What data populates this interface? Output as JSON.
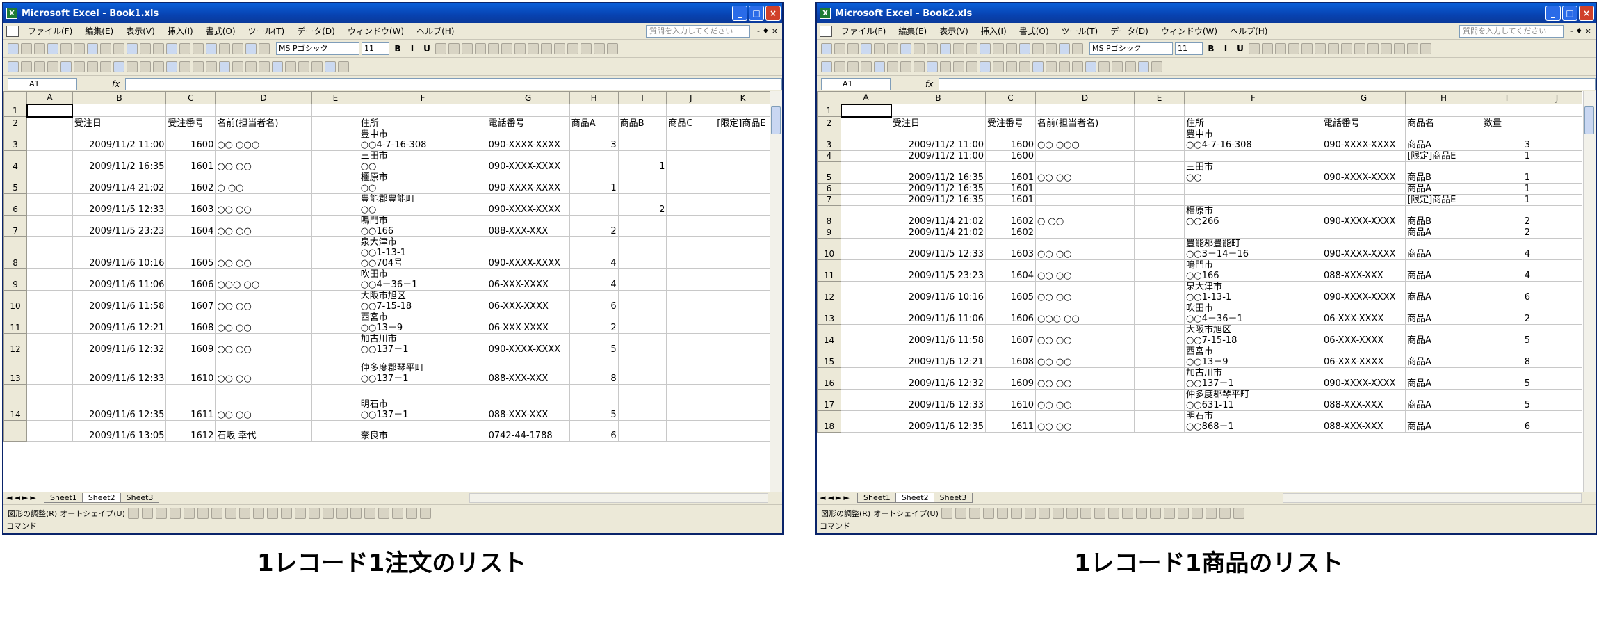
{
  "menu": [
    "ファイル(F)",
    "編集(E)",
    "表示(V)",
    "挿入(I)",
    "書式(O)",
    "ツール(T)",
    "データ(D)",
    "ウィンドウ(W)",
    "ヘルプ(H)"
  ],
  "help_placeholder": "質問を入力してください",
  "font_name": "MS Pゴシック",
  "font_size": "11",
  "cell_ref": "A1",
  "fx": "fx",
  "status": "コマンド",
  "sheets": [
    "Sheet1",
    "Sheet2",
    "Sheet3"
  ],
  "drawing_label": "図形の調整(R)",
  "autoshape_label": "オートシェイプ(U)",
  "windows": [
    {
      "title": "Microsoft Excel - Book1.xls",
      "active_sheet": 1,
      "caption": "1レコード1注文のリスト",
      "columns": [
        "A",
        "B",
        "C",
        "D",
        "E",
        "F",
        "G",
        "H",
        "I",
        "J",
        "K"
      ],
      "rows": [
        {
          "n": "1",
          "c": [
            "",
            "",
            "",
            "",
            "",
            "",
            "",
            "",
            "",
            "",
            ""
          ]
        },
        {
          "n": "2",
          "c": [
            "",
            "受注日",
            "受注番号",
            "名前(担当者名)",
            "",
            "住所",
            "電話番号",
            "商品A",
            "商品B",
            "商品C",
            "[限定]商品E"
          ]
        },
        {
          "n": "3",
          "c": [
            "",
            "2009/11/2 11:00",
            "1600",
            "○○ ○○○",
            "",
            "豊中市\n○○4-7-16-308",
            "090-XXXX-XXXX",
            "3",
            "",
            "",
            ""
          ]
        },
        {
          "n": "4",
          "c": [
            "",
            "2009/11/2 16:35",
            "1601",
            "○○ ○○",
            "",
            "三田市\n○○",
            "090-XXXX-XXXX",
            "",
            "1",
            "",
            ""
          ]
        },
        {
          "n": "5",
          "c": [
            "",
            "2009/11/4 21:02",
            "1602",
            "○ ○○",
            "",
            "橿原市\n○○",
            "090-XXXX-XXXX",
            "1",
            "",
            "",
            ""
          ]
        },
        {
          "n": "6",
          "c": [
            "",
            "2009/11/5 12:33",
            "1603",
            "○○ ○○",
            "",
            "豊能郡豊能町\n○○",
            "090-XXXX-XXXX",
            "",
            "2",
            "",
            ""
          ]
        },
        {
          "n": "7",
          "c": [
            "",
            "2009/11/5 23:23",
            "1604",
            "○○ ○○",
            "",
            "鳴門市\n○○166",
            "088-XXX-XXX",
            "2",
            "",
            "",
            ""
          ]
        },
        {
          "n": "8",
          "c": [
            "",
            "2009/11/6 10:16",
            "1605",
            "○○ ○○",
            "",
            "泉大津市\n○○1-13-1\n○○704号",
            "090-XXXX-XXXX",
            "4",
            "",
            "",
            ""
          ]
        },
        {
          "n": "9",
          "c": [
            "",
            "2009/11/6 11:06",
            "1606",
            "○○○ ○○",
            "",
            "吹田市\n○○4－36－1",
            "06-XXX-XXXX",
            "4",
            "",
            "",
            ""
          ]
        },
        {
          "n": "10",
          "c": [
            "",
            "2009/11/6 11:58",
            "1607",
            "○○ ○○",
            "",
            "大阪市旭区\n○○7-15-18",
            "06-XXX-XXXX",
            "6",
            "",
            "",
            ""
          ]
        },
        {
          "n": "11",
          "c": [
            "",
            "2009/11/6 12:21",
            "1608",
            "○○ ○○",
            "",
            "西宮市\n○○13－9",
            "06-XXX-XXXX",
            "2",
            "",
            "",
            ""
          ]
        },
        {
          "n": "12",
          "c": [
            "",
            "2009/11/6 12:32",
            "1609",
            "○○ ○○",
            "",
            "加古川市\n○○137－1",
            "090-XXXX-XXXX",
            "5",
            "",
            "",
            ""
          ]
        },
        {
          "n": "13",
          "c": [
            "",
            "2009/11/6 12:33",
            "1610",
            "○○ ○○",
            "",
            "仲多度郡琴平町\n○○137－1",
            "088-XXX-XXX",
            "8",
            "",
            "",
            ""
          ]
        },
        {
          "n": "14",
          "c": [
            "",
            "2009/11/6 12:35",
            "1611",
            "○○ ○○",
            "",
            "明石市\n○○137－1",
            "088-XXX-XXX",
            "5",
            "",
            "",
            ""
          ]
        },
        {
          "n": "",
          "c": [
            "",
            "2009/11/6 13:05",
            "1612",
            "石坂 幸代",
            "",
            "奈良市",
            "0742-44-1788",
            "6",
            "",
            "",
            ""
          ]
        }
      ]
    },
    {
      "title": "Microsoft Excel - Book2.xls",
      "active_sheet": 1,
      "caption": "1レコード1商品のリスト",
      "columns": [
        "A",
        "B",
        "C",
        "D",
        "E",
        "F",
        "G",
        "H",
        "I",
        "J"
      ],
      "rows": [
        {
          "n": "1",
          "c": [
            "",
            "",
            "",
            "",
            "",
            "",
            "",
            "",
            "",
            ""
          ]
        },
        {
          "n": "2",
          "c": [
            "",
            "受注日",
            "受注番号",
            "名前(担当者名)",
            "",
            "住所",
            "電話番号",
            "商品名",
            "数量",
            ""
          ]
        },
        {
          "n": "3",
          "c": [
            "",
            "2009/11/2 11:00",
            "1600",
            "○○ ○○○",
            "",
            "豊中市\n○○4-7-16-308",
            "090-XXXX-XXXX",
            "商品A",
            "3",
            ""
          ]
        },
        {
          "n": "4",
          "c": [
            "",
            "2009/11/2 11:00",
            "1600",
            "",
            "",
            "",
            "",
            "[限定]商品E",
            "1",
            ""
          ]
        },
        {
          "n": "5",
          "c": [
            "",
            "2009/11/2 16:35",
            "1601",
            "○○ ○○",
            "",
            "三田市\n○○",
            "090-XXXX-XXXX",
            "商品B",
            "1",
            ""
          ]
        },
        {
          "n": "6",
          "c": [
            "",
            "2009/11/2 16:35",
            "1601",
            "",
            "",
            "",
            "",
            "商品A",
            "1",
            ""
          ]
        },
        {
          "n": "7",
          "c": [
            "",
            "2009/11/2 16:35",
            "1601",
            "",
            "",
            "",
            "",
            "[限定]商品E",
            "1",
            ""
          ]
        },
        {
          "n": "8",
          "c": [
            "",
            "2009/11/4 21:02",
            "1602",
            "○ ○○",
            "",
            "橿原市\n○○266",
            "090-XXXX-XXXX",
            "商品B",
            "2",
            ""
          ]
        },
        {
          "n": "9",
          "c": [
            "",
            "2009/11/4 21:02",
            "1602",
            "",
            "",
            "",
            "",
            "商品A",
            "2",
            ""
          ]
        },
        {
          "n": "10",
          "c": [
            "",
            "2009/11/5 12:33",
            "1603",
            "○○ ○○",
            "",
            "豊能郡豊能町\n○○3－14－16",
            "090-XXXX-XXXX",
            "商品A",
            "4",
            ""
          ]
        },
        {
          "n": "11",
          "c": [
            "",
            "2009/11/5 23:23",
            "1604",
            "○○ ○○",
            "",
            "鳴門市\n○○166",
            "088-XXX-XXX",
            "商品A",
            "4",
            ""
          ]
        },
        {
          "n": "12",
          "c": [
            "",
            "2009/11/6 10:16",
            "1605",
            "○○ ○○",
            "",
            "泉大津市\n○○1-13-1",
            "090-XXXX-XXXX",
            "商品A",
            "6",
            ""
          ]
        },
        {
          "n": "13",
          "c": [
            "",
            "2009/11/6 11:06",
            "1606",
            "○○○ ○○",
            "",
            "吹田市\n○○4－36－1",
            "06-XXX-XXXX",
            "商品A",
            "2",
            ""
          ]
        },
        {
          "n": "14",
          "c": [
            "",
            "2009/11/6 11:58",
            "1607",
            "○○ ○○",
            "",
            "大阪市旭区\n○○7-15-18",
            "06-XXX-XXXX",
            "商品A",
            "5",
            ""
          ]
        },
        {
          "n": "15",
          "c": [
            "",
            "2009/11/6 12:21",
            "1608",
            "○○ ○○",
            "",
            "西宮市\n○○13－9",
            "06-XXX-XXXX",
            "商品A",
            "8",
            ""
          ]
        },
        {
          "n": "16",
          "c": [
            "",
            "2009/11/6 12:32",
            "1609",
            "○○ ○○",
            "",
            "加古川市\n○○137－1",
            "090-XXXX-XXXX",
            "商品A",
            "5",
            ""
          ]
        },
        {
          "n": "17",
          "c": [
            "",
            "2009/11/6 12:33",
            "1610",
            "○○ ○○",
            "",
            "仲多度郡琴平町\n○○631-11",
            "088-XXX-XXX",
            "商品A",
            "5",
            ""
          ]
        },
        {
          "n": "18",
          "c": [
            "",
            "2009/11/6 12:35",
            "1611",
            "○○ ○○",
            "",
            "明石市\n○○868－1",
            "088-XXX-XXX",
            "商品A",
            "6",
            ""
          ]
        }
      ]
    }
  ]
}
